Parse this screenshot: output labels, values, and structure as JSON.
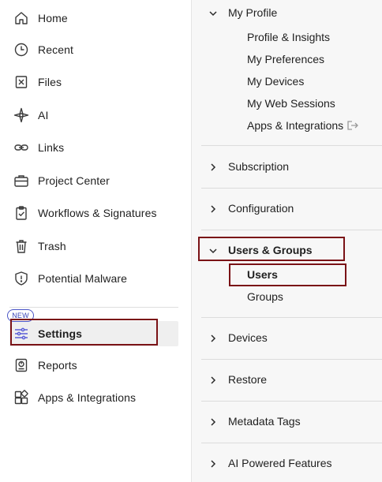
{
  "left_nav": {
    "items": [
      {
        "label": "Home",
        "icon": "home-icon"
      },
      {
        "label": "Recent",
        "icon": "clock-icon"
      },
      {
        "label": "Files",
        "icon": "files-icon"
      },
      {
        "label": "AI",
        "icon": "ai-sparkle-icon"
      },
      {
        "label": "Links",
        "icon": "link-icon"
      },
      {
        "label": "Project Center",
        "icon": "briefcase-icon"
      },
      {
        "label": "Workflows & Signatures",
        "icon": "clipboard-check-icon"
      },
      {
        "label": "Trash",
        "icon": "trash-icon"
      },
      {
        "label": "Potential Malware",
        "icon": "shield-alert-icon"
      }
    ],
    "settings": {
      "label": "Settings",
      "icon": "sliders-icon",
      "badge": "NEW",
      "selected": true
    },
    "bottom_items": [
      {
        "label": "Reports",
        "icon": "report-icon"
      },
      {
        "label": "Apps & Integrations",
        "icon": "apps-grid-icon"
      }
    ]
  },
  "right_panel": {
    "my_profile": {
      "title": "My Profile",
      "expanded": true,
      "items": [
        "Profile & Insights",
        "My Preferences",
        "My Devices",
        "My Web Sessions",
        "Apps & Integrations"
      ]
    },
    "subscription": {
      "title": "Subscription",
      "expanded": false
    },
    "configuration": {
      "title": "Configuration",
      "expanded": false
    },
    "users_groups": {
      "title": "Users & Groups",
      "expanded": true,
      "items": [
        "Users",
        "Groups"
      ],
      "selected_item": "Users"
    },
    "devices": {
      "title": "Devices",
      "expanded": false
    },
    "restore": {
      "title": "Restore",
      "expanded": false
    },
    "metadata_tags": {
      "title": "Metadata Tags",
      "expanded": false
    },
    "ai_features": {
      "title": "AI Powered Features",
      "expanded": false
    }
  },
  "colors": {
    "highlight_border": "#7a1216",
    "badge_accent": "#3944b8",
    "settings_icon": "#5b5fd6",
    "selected_bg": "#efefef",
    "panel_bg": "#f7f7f7"
  }
}
